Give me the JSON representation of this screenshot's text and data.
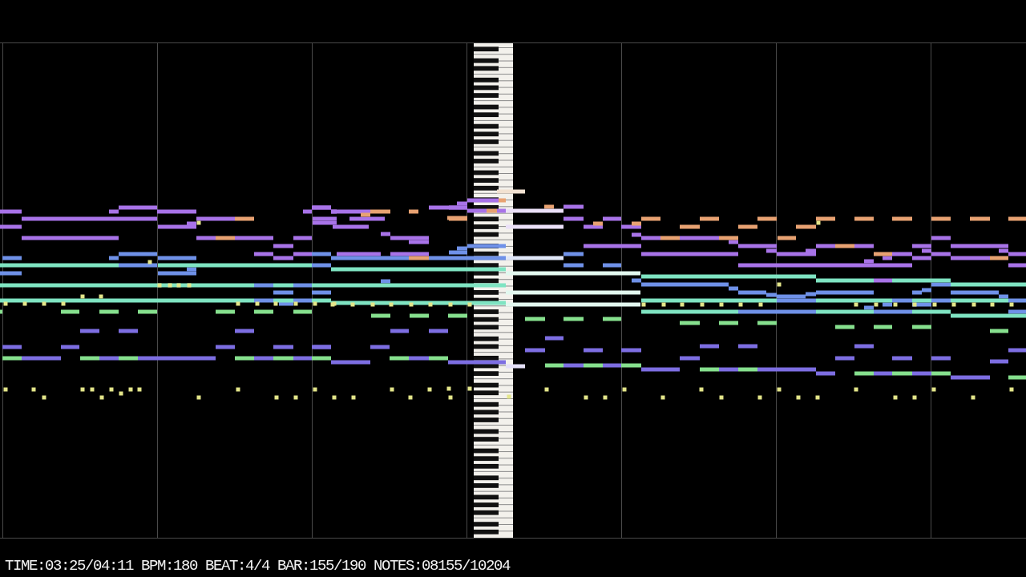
{
  "status_bar": {
    "items": [
      "TIME:03:25/04:11",
      "BPM:180",
      "BEAT:4/4",
      "BAR:155/190",
      "NOTES:08155/10204"
    ]
  }
}
